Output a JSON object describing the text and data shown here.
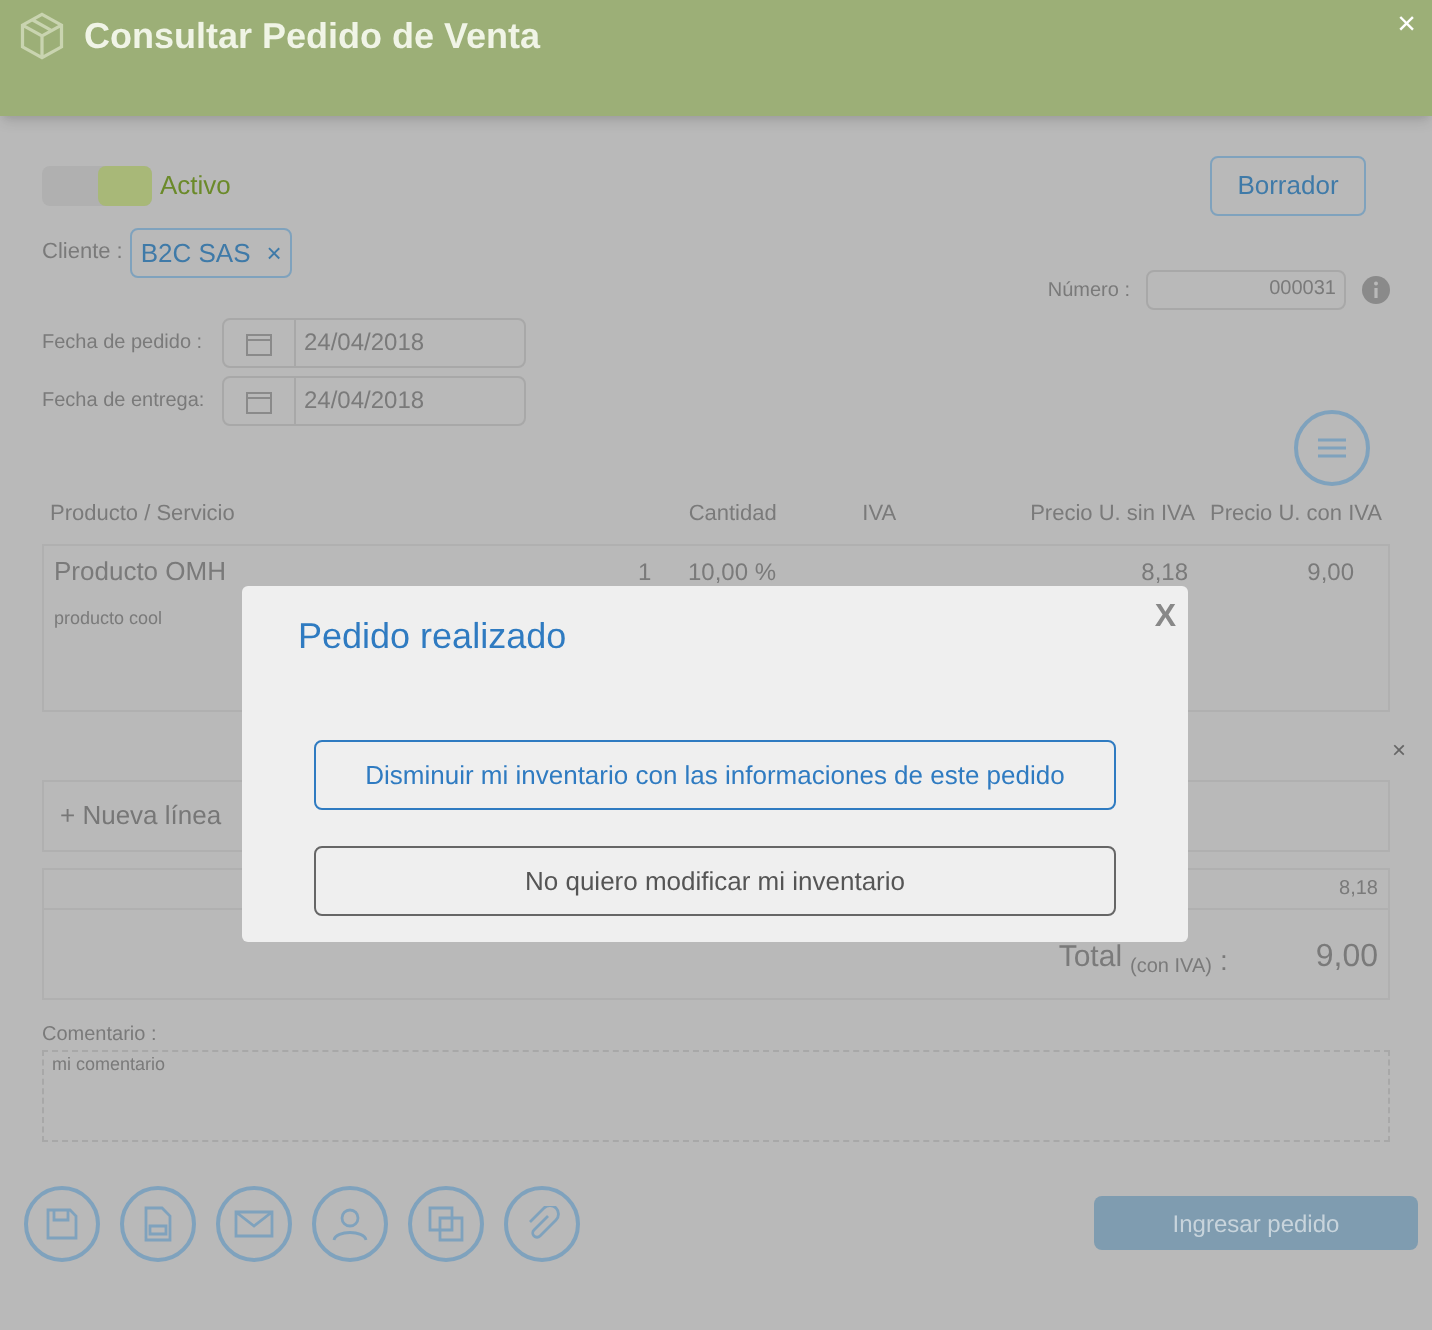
{
  "window": {
    "title": "Consultar Pedido de Venta",
    "close": "×"
  },
  "status": {
    "label": "Activo",
    "on": true
  },
  "draft_button": "Borrador",
  "client": {
    "label": "Cliente :",
    "value": "B2C SAS",
    "remove": "×"
  },
  "number": {
    "label": "Número :",
    "value": "000031"
  },
  "dates": [
    {
      "label": "Fecha de pedido :",
      "value": "24/04/2018"
    },
    {
      "label": "Fecha de entrega:",
      "value": "24/04/2018"
    }
  ],
  "table": {
    "columns": [
      "Producto / Servicio",
      "Cantidad",
      "IVA",
      "Precio U. sin IVA",
      "Precio U. con IVA"
    ],
    "rows": [
      {
        "product": "Producto OMH",
        "quantity": "1",
        "iva": "10,00 %",
        "price_without_iva": "8,18",
        "price_with_iva": "9,00",
        "description": "producto cool"
      }
    ],
    "remove": "×",
    "new_line": "+ Nueva línea"
  },
  "totals": {
    "subtotal": "8,18",
    "total_label": "Total",
    "total_note": "(con IVA)",
    "total_colon": ":",
    "total": "9,00"
  },
  "comment": {
    "label": "Comentario :",
    "value": "mi comentario"
  },
  "submit_button": "Ingresar pedido",
  "dialog": {
    "title": "Pedido realizado",
    "close": "X",
    "buttons": [
      {
        "label": "Disminuir mi inventario con las informaciones de este pedido",
        "primary": true
      },
      {
        "label": "No quiero modificar mi inventario",
        "primary": false
      }
    ]
  }
}
